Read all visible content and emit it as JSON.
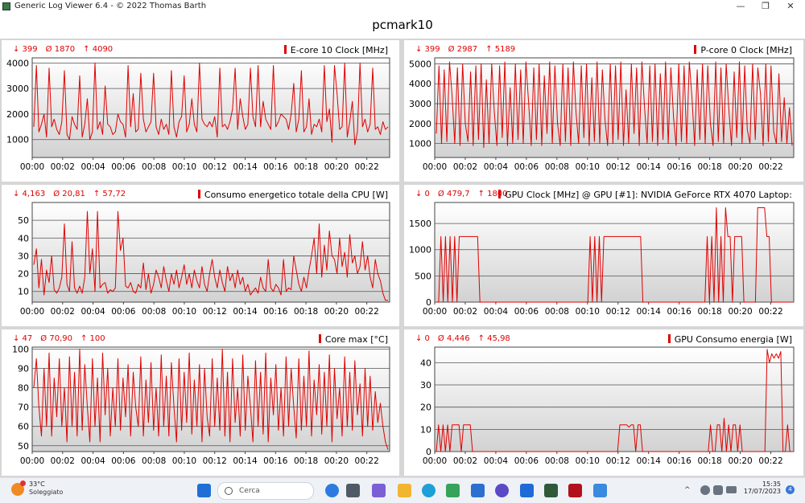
{
  "window": {
    "title": "Generic Log Viewer 6.4 - © 2022 Thomas Barth",
    "minimize": "—",
    "restore": "❐",
    "close": "✕"
  },
  "document_title": "pcmark10",
  "taskbar": {
    "weather_temp": "33°C",
    "weather_desc": "Soleggiato",
    "weather_badge": "1",
    "search_placeholder": "Cerca",
    "time": "15:35",
    "date": "17/07/2023",
    "notifications": "4",
    "tray_chevron": "^"
  },
  "chart_data": [
    {
      "type": "line",
      "title": "E-core 10 Clock [MHz]",
      "stats": {
        "min": "↓ 399",
        "avg": "Ø 1870",
        "max": "↑ 4090"
      },
      "x_ticks": [
        "00:00",
        "00:02",
        "00:04",
        "00:06",
        "00:08",
        "00:10",
        "00:12",
        "00:14",
        "00:16",
        "00:18",
        "00:20",
        "00:22"
      ],
      "x_range_minutes": [
        0,
        23.5
      ],
      "ylim": [
        300,
        4200
      ],
      "y_ticks": [
        1000,
        2000,
        3000,
        4000
      ],
      "grid": true,
      "series": [
        {
          "values": [
            1500,
            3900,
            1300,
            1600,
            2000,
            1100,
            3800,
            1500,
            1800,
            1400,
            1200,
            1700,
            3700,
            1200,
            1000,
            1900,
            1600,
            1400,
            3500,
            1100,
            1600,
            2600,
            1000,
            1300,
            4000,
            1400,
            1700,
            1200,
            3100,
            1600,
            1500,
            1200,
            1300,
            2000,
            1700,
            1600,
            1100,
            3900,
            1500,
            2800,
            1300,
            1400,
            3600,
            1800,
            1300,
            1500,
            1700,
            3600,
            1500,
            1200,
            1800,
            1400,
            1600,
            1200,
            3700,
            1500,
            1100,
            1700,
            1900,
            3500,
            1300,
            1600,
            2600,
            1600,
            1300,
            4000,
            1800,
            1600,
            1500,
            1700,
            1500,
            1900,
            1100,
            3800,
            1500,
            1600,
            1400,
            1700,
            2200,
            3800,
            1400,
            2600,
            1900,
            1400,
            1600,
            3800,
            1900,
            1500,
            3900,
            1500,
            2500,
            1800,
            1600,
            1400,
            3900,
            1500,
            1700,
            2000,
            1900,
            1800,
            1400,
            2000,
            3200,
            1300,
            1800,
            3700,
            1300,
            1500,
            2600,
            1200,
            1600,
            1500,
            1800,
            1300,
            3900,
            1700,
            2200,
            900,
            3900,
            2800,
            1400,
            1500,
            4000,
            1100,
            1700,
            2500,
            800,
            1300,
            4000,
            1500,
            1800,
            1300,
            1600,
            3800,
            1400,
            1500,
            1200,
            1700,
            1400,
            1500
          ]
        }
      ]
    },
    {
      "type": "line",
      "title": "P-core 0 Clock [MHz]",
      "stats": {
        "min": "↓ 399",
        "avg": "Ø 2987",
        "max": "↑ 5189"
      },
      "x_ticks": [
        "00:00",
        "00:02",
        "00:04",
        "00:06",
        "00:08",
        "00:10",
        "00:12",
        "00:14",
        "00:16",
        "00:18",
        "00:20",
        "00:22"
      ],
      "x_range_minutes": [
        0,
        23.5
      ],
      "ylim": [
        300,
        5300
      ],
      "y_ticks": [
        1000,
        2000,
        3000,
        4000,
        5000
      ],
      "grid": true,
      "series": [
        {
          "values": [
            1500,
            4900,
            1000,
            4700,
            1100,
            5100,
            3400,
            1000,
            4800,
            900,
            5000,
            2000,
            1100,
            4600,
            900,
            4900,
            1200,
            5000,
            800,
            4200,
            1000,
            5000,
            2600,
            900,
            4900,
            1300,
            5100,
            900,
            3800,
            1000,
            5000,
            1200,
            4700,
            1000,
            5100,
            3100,
            900,
            4800,
            1200,
            5000,
            900,
            4400,
            1500,
            5100,
            1000,
            4900,
            2000,
            900,
            5000,
            1100,
            4800,
            900,
            5100,
            2600,
            1000,
            4900,
            1300,
            5000,
            900,
            4300,
            1100,
            5100,
            1000,
            4700,
            2200,
            900,
            5000,
            1000,
            4900,
            1200,
            5100,
            900,
            3700,
            1000,
            5000,
            1500,
            4800,
            900,
            5100,
            2800,
            1000,
            4900,
            1100,
            5000,
            900,
            4500,
            1200,
            5100,
            1000,
            4800,
            2300,
            900,
            5000,
            1100,
            4900,
            1000,
            5100,
            3300,
            900,
            4700,
            1200,
            5000,
            1000,
            4900,
            2000,
            900,
            5100,
            1100,
            4800,
            1000,
            5000,
            2700,
            900,
            4600,
            1300,
            5100,
            1000,
            4900,
            1700,
            1000,
            5000,
            1200,
            4800,
            3500,
            900,
            5000,
            1100,
            4900,
            1600,
            1000,
            4500,
            1100,
            3300,
            1000,
            2800,
            900
          ]
        }
      ]
    },
    {
      "type": "line",
      "title": "Consumo energetico totale della CPU [W]",
      "stats": {
        "min": "↓ 4,163",
        "avg": "Ø 20,81",
        "max": "↑ 57,72"
      },
      "x_ticks": [
        "00:00",
        "00:02",
        "00:04",
        "00:06",
        "00:08",
        "00:10",
        "00:12",
        "00:14",
        "00:16",
        "00:18",
        "00:20",
        "00:22"
      ],
      "x_range_minutes": [
        0,
        23.5
      ],
      "ylim": [
        4,
        60
      ],
      "y_ticks": [
        10,
        20,
        30,
        40,
        50
      ],
      "grid": true,
      "series": [
        {
          "values": [
            25,
            34,
            12,
            28,
            8,
            22,
            15,
            30,
            11,
            9,
            12,
            18,
            48,
            14,
            10,
            38,
            12,
            9,
            13,
            9,
            18,
            55,
            20,
            34,
            10,
            55,
            12,
            14,
            15,
            9,
            11,
            10,
            12,
            55,
            33,
            40,
            13,
            12,
            15,
            10,
            9,
            14,
            12,
            26,
            11,
            20,
            9,
            14,
            22,
            18,
            12,
            24,
            16,
            10,
            20,
            14,
            22,
            12,
            18,
            25,
            14,
            20,
            12,
            22,
            16,
            12,
            24,
            14,
            10,
            20,
            28,
            18,
            12,
            22,
            15,
            10,
            24,
            16,
            20,
            12,
            22,
            14,
            18,
            10,
            14,
            8,
            10,
            12,
            9,
            18,
            12,
            10,
            28,
            12,
            10,
            14,
            12,
            8,
            28,
            10,
            12,
            11,
            30,
            22,
            14,
            10,
            18,
            12,
            22,
            30,
            40,
            20,
            48,
            18,
            36,
            22,
            44,
            30,
            28,
            20,
            40,
            24,
            32,
            18,
            42,
            26,
            30,
            20,
            24,
            38,
            22,
            30,
            18,
            12,
            28,
            20,
            16,
            9,
            5,
            5
          ]
        }
      ]
    },
    {
      "type": "line",
      "title": "GPU Clock [MHz] @ GPU [#1]: NVIDIA GeForce RTX 4070 Laptop:",
      "stats": {
        "min": "↓ 0",
        "avg": "Ø 479,7",
        "max": "↑ 1800"
      },
      "x_ticks": [
        "00:00",
        "00:02",
        "00:04",
        "00:06",
        "00:08",
        "00:10",
        "00:12",
        "00:14",
        "00:16",
        "00:18",
        "00:20",
        "00:22"
      ],
      "x_range_minutes": [
        0,
        23.5
      ],
      "ylim": [
        0,
        1900
      ],
      "y_ticks": [
        0,
        500,
        1000,
        1500
      ],
      "grid": true,
      "series": [
        {
          "values": [
            0,
            0,
            1250,
            0,
            1250,
            0,
            1250,
            0,
            1250,
            0,
            1250,
            1250,
            1250,
            1250,
            1250,
            1250,
            1250,
            1250,
            1250,
            0,
            0,
            0,
            0,
            0,
            0,
            0,
            0,
            0,
            0,
            0,
            0,
            0,
            0,
            0,
            0,
            0,
            0,
            0,
            0,
            0,
            0,
            0,
            0,
            0,
            0,
            0,
            0,
            0,
            0,
            0,
            0,
            0,
            0,
            0,
            0,
            0,
            0,
            0,
            0,
            0,
            0,
            0,
            0,
            0,
            0,
            0,
            0,
            1250,
            0,
            1250,
            0,
            1250,
            0,
            1250,
            1250,
            1250,
            1250,
            1250,
            1250,
            1250,
            1250,
            1250,
            1250,
            1250,
            1250,
            1250,
            1250,
            1250,
            1250,
            1250,
            0,
            0,
            0,
            0,
            0,
            0,
            0,
            0,
            0,
            0,
            0,
            0,
            0,
            0,
            0,
            0,
            0,
            0,
            0,
            0,
            0,
            0,
            0,
            0,
            0,
            0,
            0,
            0,
            1250,
            0,
            1250,
            0,
            1800,
            0,
            1250,
            0,
            1800,
            1250,
            1250,
            0,
            1250,
            1250,
            1250,
            1250,
            0,
            0,
            0,
            0,
            0,
            0,
            1800,
            1800,
            1800,
            1800,
            1250,
            1250,
            0,
            0,
            0,
            0,
            0,
            0,
            0,
            0,
            0,
            0
          ]
        }
      ]
    },
    {
      "type": "line",
      "title": "Core max [°C]",
      "stats": {
        "min": "↓ 47",
        "avg": "Ø 70,90",
        "max": "↑ 100"
      },
      "x_ticks": [
        "00:00",
        "00:02",
        "00:04",
        "00:06",
        "00:08",
        "00:10",
        "00:12",
        "00:14",
        "00:16",
        "00:18",
        "00:20",
        "00:22"
      ],
      "x_range_minutes": [
        0,
        23.5
      ],
      "ylim": [
        47,
        101
      ],
      "y_ticks": [
        50,
        60,
        70,
        80,
        90,
        100
      ],
      "grid": true,
      "series": [
        {
          "values": [
            80,
            95,
            70,
            55,
            90,
            60,
            98,
            55,
            85,
            65,
            95,
            60,
            80,
            52,
            96,
            60,
            88,
            55,
            100,
            58,
            92,
            70,
            52,
            95,
            60,
            85,
            52,
            98,
            66,
            90,
            55,
            80,
            60,
            95,
            58,
            85,
            65,
            92,
            55,
            88,
            70,
            60,
            96,
            55,
            84,
            62,
            93,
            58,
            80,
            55,
            97,
            60,
            86,
            55,
            93,
            70,
            52,
            95,
            58,
            88,
            62,
            98,
            56,
            84,
            60,
            92,
            52,
            90,
            65,
            55,
            95,
            60,
            85,
            58,
            100,
            55,
            88,
            52,
            95,
            62,
            80,
            55,
            97,
            58,
            86,
            70,
            52,
            94,
            60,
            88,
            56,
            98,
            52,
            85,
            66,
            92,
            58,
            80,
            55,
            96,
            60,
            90,
            70,
            54,
            95,
            58,
            86,
            60,
            99,
            55,
            84,
            66,
            92,
            56,
            88,
            60,
            97,
            52,
            90,
            64,
            80,
            55,
            96,
            60,
            88,
            58,
            94,
            66,
            82,
            55,
            90,
            60,
            86,
            58,
            78,
            62,
            72,
            60,
            52,
            48
          ]
        }
      ]
    },
    {
      "type": "line",
      "title": "GPU Consumo energia [W]",
      "stats": {
        "min": "↓ 0",
        "avg": "Ø 4,446",
        "max": "↑ 45,98"
      },
      "x_ticks": [
        "00:00",
        "00:02",
        "00:04",
        "00:06",
        "00:08",
        "00:10",
        "00:12",
        "00:14",
        "00:16",
        "00:18",
        "00:20",
        "00:22"
      ],
      "x_range_minutes": [
        0,
        23.5
      ],
      "ylim": [
        0,
        47
      ],
      "y_ticks": [
        0,
        10,
        20,
        30,
        40
      ],
      "grid": true,
      "series": [
        {
          "values": [
            0,
            12,
            0,
            12,
            0,
            12,
            0,
            12,
            12,
            12,
            12,
            0,
            12,
            12,
            12,
            12,
            0,
            0,
            0,
            0,
            0,
            0,
            0,
            0,
            0,
            0,
            0,
            0,
            0,
            0,
            0,
            0,
            0,
            0,
            0,
            0,
            0,
            0,
            0,
            0,
            0,
            0,
            0,
            0,
            0,
            0,
            0,
            0,
            0,
            0,
            0,
            0,
            0,
            0,
            0,
            0,
            0,
            0,
            0,
            0,
            0,
            0,
            0,
            0,
            0,
            0,
            0,
            0,
            0,
            0,
            0,
            0,
            0,
            0,
            0,
            0,
            0,
            0,
            0,
            0,
            0,
            12,
            12,
            12,
            12,
            11,
            12,
            12,
            0,
            12,
            12,
            0,
            0,
            0,
            0,
            0,
            0,
            0,
            0,
            0,
            0,
            0,
            0,
            0,
            0,
            0,
            0,
            0,
            0,
            0,
            0,
            0,
            0,
            0,
            0,
            0,
            0,
            0,
            0,
            0,
            0,
            12,
            0,
            0,
            12,
            12,
            0,
            15,
            0,
            12,
            0,
            12,
            12,
            0,
            12,
            0,
            0,
            0,
            0,
            0,
            0,
            0,
            0,
            0,
            0,
            0,
            46,
            40,
            44,
            42,
            44,
            42,
            45,
            0,
            0,
            12,
            0,
            0
          ]
        }
      ]
    }
  ]
}
